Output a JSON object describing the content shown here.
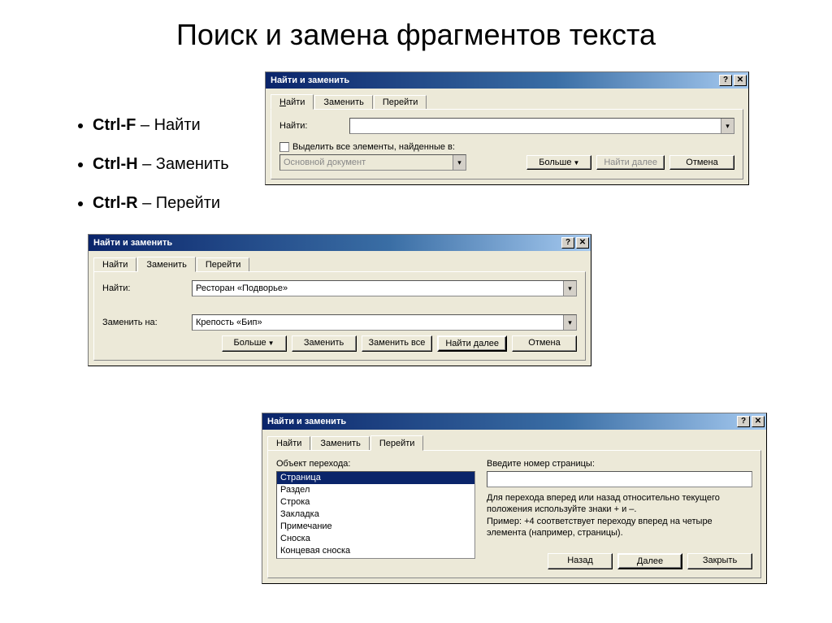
{
  "page": {
    "title": "Поиск и замена фрагментов текста"
  },
  "bullets": [
    {
      "key": "Ctrl-F",
      "label": "Найти"
    },
    {
      "key": "Ctrl-H",
      "label": "Заменить"
    },
    {
      "key": "Ctrl-R",
      "label": "Перейти"
    }
  ],
  "dlg1": {
    "title": "Найти и заменить",
    "tabs": {
      "find": "Найти",
      "replace": "Заменить",
      "goto": "Перейти"
    },
    "find_label": "Найти:",
    "find_value": "",
    "highlight_label": "Выделить все элементы, найденные в:",
    "scope_value": "Основной документ",
    "btn_more": "Больше",
    "btn_findnext": "Найти далее",
    "btn_cancel": "Отмена"
  },
  "dlg2": {
    "title": "Найти и заменить",
    "tabs": {
      "find": "Найти",
      "replace": "Заменить",
      "goto": "Перейти"
    },
    "find_label": "Найти:",
    "find_value": "Ресторан «Подворье»",
    "replace_label": "Заменить на:",
    "replace_value": "Крепость «Бип»",
    "btn_more": "Больше",
    "btn_replace": "Заменить",
    "btn_replaceall": "Заменить все",
    "btn_findnext": "Найти далее",
    "btn_cancel": "Отмена"
  },
  "dlg3": {
    "title": "Найти и заменить",
    "tabs": {
      "find": "Найти",
      "replace": "Заменить",
      "goto": "Перейти"
    },
    "object_label": "Объект перехода:",
    "list": [
      "Страница",
      "Раздел",
      "Строка",
      "Закладка",
      "Примечание",
      "Сноска",
      "Концевая сноска"
    ],
    "selected": "Страница",
    "enter_label": "Введите номер страницы:",
    "input_value": "",
    "help1": "Для перехода вперед или назад относительно текущего положения используйте знаки + и –.",
    "help2": "Пример: +4 соответствует переходу вперед на четыре элемента (например, страницы).",
    "btn_back": "Назад",
    "btn_next": "Далее",
    "btn_close": "Закрыть"
  }
}
